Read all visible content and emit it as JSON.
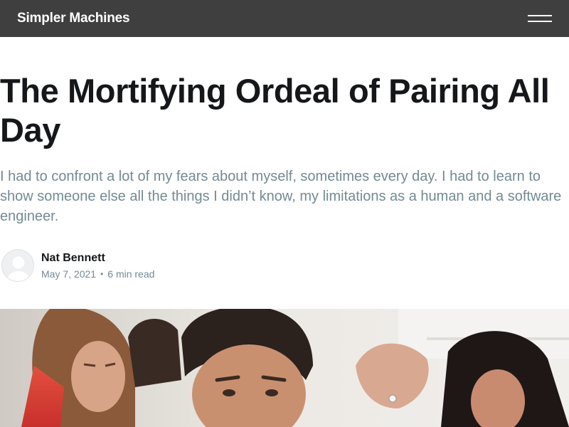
{
  "header": {
    "site_title": "Simpler Machines",
    "menu_icon": "hamburger-menu-icon"
  },
  "post": {
    "title": "The Mortifying Ordeal of Pairing All Day",
    "excerpt": "I had to confront a lot of my fears about myself, sometimes every day. I had to learn to show someone else all the things I didn’t know, my limitations as a human and a software engineer.",
    "author": {
      "name": "Nat Bennett",
      "avatar_icon": "avatar-placeholder-icon"
    },
    "date": "May 7, 2021",
    "separator": "•",
    "reading_time": "6 min read"
  },
  "feature_image": {
    "subject": "group-of-people-photo"
  },
  "colors": {
    "header_bg": "#3f3f3f",
    "title": "#15171a",
    "muted": "#738a94"
  }
}
